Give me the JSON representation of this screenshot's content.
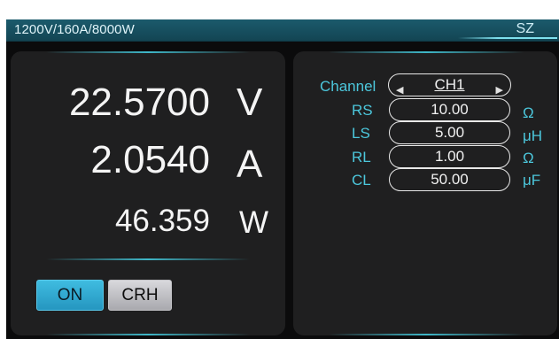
{
  "header": {
    "spec": "1200V/160A/8000W",
    "mode": "SZ"
  },
  "readings": [
    {
      "value": "22.5700",
      "unit": "V"
    },
    {
      "value": "2.0540",
      "unit": "A"
    },
    {
      "value": "46.359",
      "unit": "W"
    }
  ],
  "buttons": {
    "on": "ON",
    "crh": "CRH"
  },
  "params": {
    "channel_label": "Channel",
    "channel_value": "CH1",
    "rows": [
      {
        "label": "RS",
        "value": "10.00",
        "unit": "Ω"
      },
      {
        "label": "LS",
        "value": "5.00",
        "unit": "μH"
      },
      {
        "label": "RL",
        "value": "1.00",
        "unit": "Ω"
      },
      {
        "label": "CL",
        "value": "50.00",
        "unit": "μF"
      }
    ]
  },
  "colors": {
    "accent": "#4cc7dc",
    "on_button": "#2ea8d2",
    "header": "#1b5a6c"
  }
}
